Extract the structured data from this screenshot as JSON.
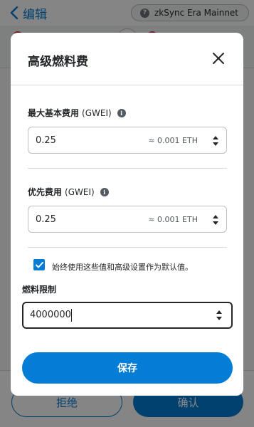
{
  "header": {
    "back_label": "编辑",
    "network_name": "zkSync Era Mainnet",
    "network_icon_glyph": "?"
  },
  "footer": {
    "reject_label": "拒绝",
    "confirm_label": "确认"
  },
  "modal": {
    "title": "高级燃料费",
    "max_base_fee": {
      "label": "最大基本费用",
      "unit": "(GWEI)",
      "value": "0.25",
      "conversion": "≈ 0.001 ETH"
    },
    "priority_fee": {
      "label": "优先费用",
      "unit": "(GWEI)",
      "value": "0.25",
      "conversion": "≈ 0.001 ETH"
    },
    "default_checkbox": {
      "label": "始终使用这些值和高级设置作为默认值。",
      "checked": true
    },
    "gas_limit": {
      "label": "燃料限制",
      "value": "4000000"
    },
    "save_label": "保存"
  },
  "colors": {
    "accent": "#037dd6",
    "text": "#24272a",
    "border": "#bbc0c5",
    "error_dot": "#d73847"
  }
}
